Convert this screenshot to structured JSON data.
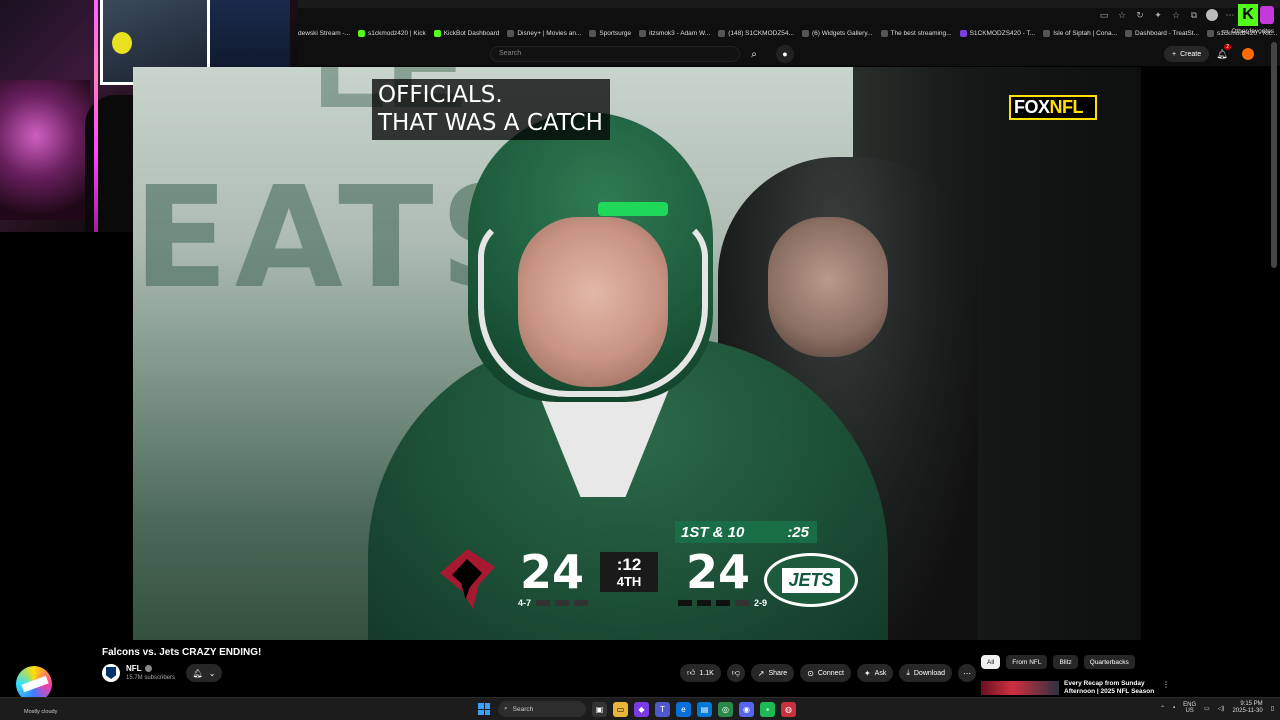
{
  "browser": {
    "bookmarks": [
      "dewski Stream -...",
      "s1ckmodz420 | Kick",
      "KickBot Dashboard",
      "Disney+ | Movies an...",
      "Sportsurge",
      "itzsmok3 - Adam W...",
      "(148) S1CKMODZ54...",
      "(6) Widgets Gallery...",
      "The best streaming...",
      "S1CKMODZS420 - T...",
      "Isle of Siptah | Cona...",
      "Dashboard - TreatSt...",
      "s1ckmodz420 - Kic..."
    ],
    "other_favorites": "Other favorites"
  },
  "youtube": {
    "search_placeholder": "Search",
    "create_label": "Create",
    "notification_count": "2"
  },
  "video": {
    "caption_line1": "OFFICIALS.",
    "caption_line2": "THAT WAS A CATCH",
    "network_logo_main": "FOX",
    "network_logo_sub": "NFL",
    "scorebug": {
      "down_distance": "1ST & 10",
      "play_clock": ":25",
      "away_score": "24",
      "home_score": "24",
      "game_clock": ":12",
      "quarter": "4TH",
      "away_record": "4-7",
      "home_record": "2-9",
      "home_team_logo_text": "JETS"
    }
  },
  "details": {
    "title": "Falcons vs. Jets CRAZY ENDING!",
    "channel_name": "NFL",
    "subscribers": "15.7M subscribers",
    "like_count": "1.1K",
    "share_label": "Share",
    "connect_label": "Connect",
    "ask_label": "Ask",
    "download_label": "Download"
  },
  "sidebar": {
    "chips": [
      "All",
      "From NFL",
      "Blitz",
      "Quarterbacks"
    ],
    "rec_title": "Every Recap from Sunday Afternoon | 2025 NFL Season"
  },
  "taskbar": {
    "weather": "Mostly cloudy",
    "search_label": "Search",
    "lang_line1": "ENG",
    "lang_line2": "US",
    "time": "9:15 PM",
    "date": "2025-11-30"
  },
  "colors": {
    "jets_green": "#125740",
    "falcons_red": "#a71930",
    "fox_yellow": "#ffe000",
    "kick_green": "#53fc18"
  }
}
